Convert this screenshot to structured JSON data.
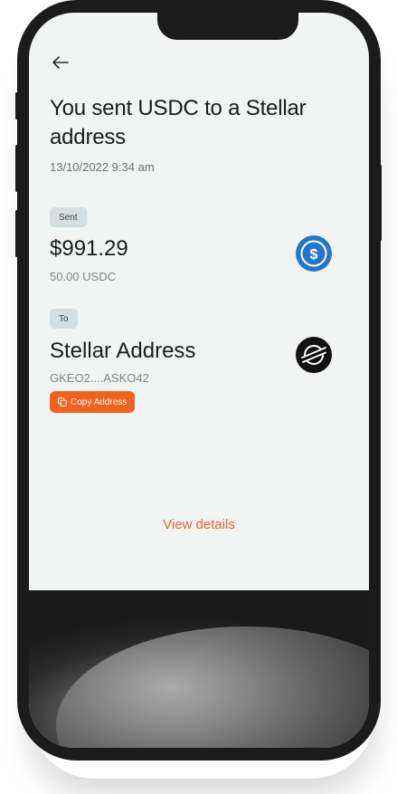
{
  "header": {
    "back_icon": "arrow-left-icon"
  },
  "transaction": {
    "title": "You sent USDC to a Stellar address",
    "timestamp": "13/10/2022 9:34 am",
    "sent_label": "Sent",
    "amount_fiat": "$991.29",
    "amount_crypto": "50.00 USDC",
    "asset_icon": "usdc-icon",
    "to_label": "To",
    "recipient_name": "Stellar Address",
    "recipient_address": "GKEO2....ASKO42",
    "recipient_icon": "stellar-icon",
    "copy_label": "Copy Address",
    "copy_icon": "copy-icon"
  },
  "footer": {
    "view_details_label": "View details"
  },
  "colors": {
    "accent": "#f3621c",
    "link": "#e8642a",
    "usdc_blue": "#2775ca",
    "pill_bg": "#d3dfe0",
    "screen_bg": "#f2f4f3"
  }
}
